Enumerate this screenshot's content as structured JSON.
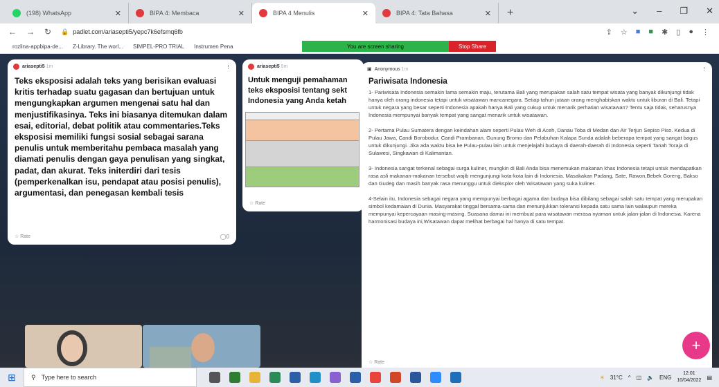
{
  "tabs": [
    {
      "label": "(198) WhatsApp",
      "color": "#25d366"
    },
    {
      "label": "BIPA 4: Membaca",
      "color": "#e0393e"
    },
    {
      "label": "BIPA 4 Menulis",
      "color": "#e0393e"
    },
    {
      "label": "BIPA 4: Tata Bahasa",
      "color": "#e0393e"
    }
  ],
  "address": {
    "url": "padlet.com/ariasepti5/yepc7k6efsmq6fb"
  },
  "bookmarks": [
    "rozlina-appbipa-de...",
    "Z-Library. The worl...",
    "SIMPEL-PRO TRIAL",
    "Instrumen Pena"
  ],
  "share_bar": {
    "text": "You are screen sharing",
    "stop": "Stop Share"
  },
  "card1": {
    "author": "ariasepti5",
    "time": "1m",
    "text": "Teks eksposisi adalah teks yang berisikan evaluasi kritis terhadap suatu gagasan dan bertujuan untuk mengungkapkan argumen mengenai satu hal dan menjustifikasinya. Teks ini biasanya ditemukan dalam esai, editorial, debat politik atau commentaries.Teks eksposisi memiliki fungsi sosial sebagai sarana penulis untuk memberitahu pembaca masalah yang diamati penulis dengan gaya penulisan yang singkat, padat, dan akurat. Teks initerdiri dari tesis (pemperkenalkan isu, pendapat atau posisi penulis), argumentasi, dan penegasan kembali tesis",
    "rate": "Rate",
    "comments": "0"
  },
  "card2": {
    "author": "ariasepti5",
    "time": "5m",
    "lines": [
      "Untuk menguji pemahaman",
      "teks eksposisi tentang sekt",
      "Indonesia yang Anda ketah"
    ],
    "rate": "Rate"
  },
  "card3": {
    "author": "Anonymous",
    "time": "1m",
    "title": "Pariwisata Indonesia",
    "paragraphs": [
      "1- Pariwisata Indonesia semakin lama semakin maju, terutama Bali yang merupakan salah satu tempat wisata yang banyak dikunjungi tidak hanya oleh orang indonesia tetapi untuk wisatawan mancanegara. Setiap tahun jutaan orang menghabiskan waktu untuk liburan di Bali. Tetapi untuk negara yang besar seperti Indonesia apakah hanya Bali yang cukup untuk menarik perhatian wisatawan? Tentu saja tidak, seharusnya Indonesia mempunyai banyak tempat yang sangat menarik untuk wisatawan.",
      "2- Pertama Pulau Sumatera dengan keindahan alam seperti Pulau Weh di Aceh, Danau Toba di Medan dan Air Terjun Sepiso Piso. Kedua di Pulau Jawa, Candi Borobodur, Candi Prambanan, Gunung Bromo dan Pelabuhan Kalapa Sunda adalah beberapa tempat yang sangat bagus untuk dikunjungi. Jika ada waktu bisa ke Pulau-pulau lain untuk menjelajahi budaya di daerah-daerah di Indonesia seperti Tanah Toraja di Sulawesi, Singkawan di Kalimantan.",
      "3- Indonesia sangat terkenal sebagai surga kuliner, mungkin di Bali Anda bisa menemukan makanan khas Indonesia tetapi untuk mendapatkan rasa asli makanan-makanan tersebut wajib mengunjungi kota-kota lain di Indonesia. Masakakan Padang, Sate, Rawon,Bebek Goreng, Bakso dan Gudeg dan masih banyak rasa menunggu untuk dieksplor oleh Wisatawan yang suka kuliner.",
      "4-Selain itu, Indonesia sebagai negara yang mempunyai berbagai agama dan budaya bisa dibilang sebagai salah satu tempat yang merupakan simbol kedamaian di Dunia. Masyarakat tinggal bersama-sama dan menunjukkan toleransi kepada satu sama lain walaupun mereka mempunyai kepercayaan masing-masing. Suasana damai ini membuat para wisatawan merasa nyaman untuk jalan-jalan di Indonesia. Karena harmonisasi budaya ini,Wisatawan dapat melihat berbagai hal hanya di satu tempat."
    ],
    "rate": "Rate"
  },
  "taskbar": {
    "search": "Type here to search",
    "weather": "31°C",
    "lang": "ENG",
    "time": "12:01",
    "date": "10/04/2022"
  }
}
